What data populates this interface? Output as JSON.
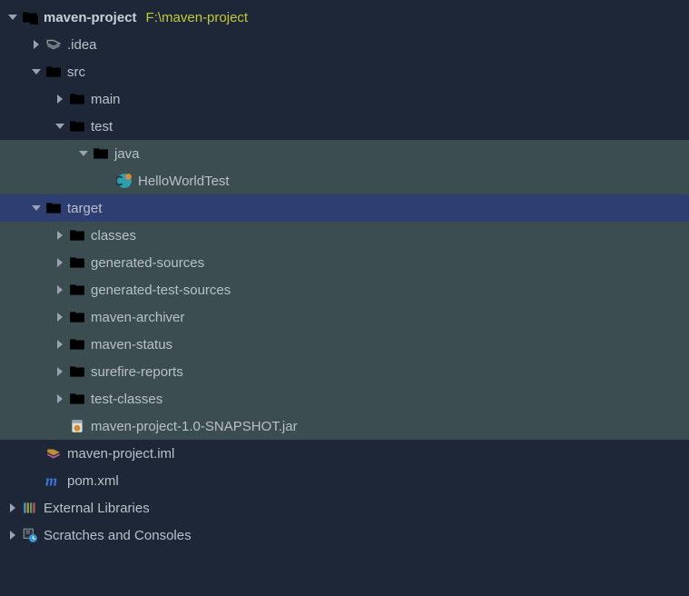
{
  "root": {
    "name": "maven-project",
    "path": "F:\\maven-project"
  },
  "idea": ".idea",
  "src": "src",
  "main": "main",
  "test": "test",
  "java": "java",
  "helloTest": "HelloWorldTest",
  "target": "target",
  "classes": "classes",
  "genSources": "generated-sources",
  "genTestSources": "generated-test-sources",
  "mavenArchiver": "maven-archiver",
  "mavenStatus": "maven-status",
  "surefire": "surefire-reports",
  "testClasses": "test-classes",
  "jar": "maven-project-1.0-SNAPSHOT.jar",
  "iml": "maven-project.iml",
  "pom": "pom.xml",
  "extLibs": "External Libraries",
  "scratches": "Scratches and Consoles"
}
